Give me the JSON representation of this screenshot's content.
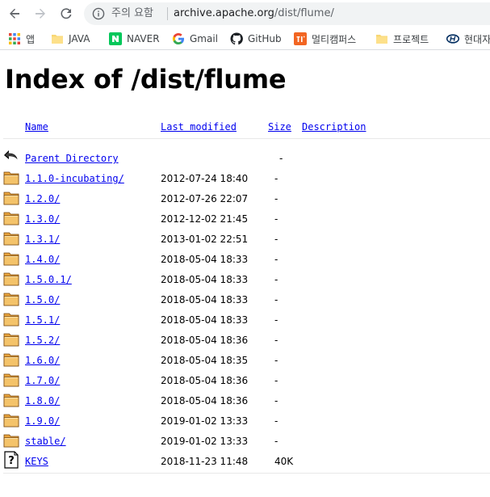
{
  "browser": {
    "security_label": "주의 요함",
    "url_host": "archive.apache.org",
    "url_path": "/dist/flume/"
  },
  "bookmarks": [
    {
      "label": "앱",
      "icon": "apps-grid-icon"
    },
    {
      "label": "JAVA",
      "icon": "folder-icon"
    },
    {
      "label": "NAVER",
      "icon": "naver-icon"
    },
    {
      "label": "Gmail",
      "icon": "google-icon"
    },
    {
      "label": "GitHub",
      "icon": "github-icon"
    },
    {
      "label": "멀티캠퍼스",
      "icon": "multicampus-icon"
    },
    {
      "label": "프로젝트",
      "icon": "folder-icon"
    },
    {
      "label": "현대자",
      "icon": "hyundai-icon"
    }
  ],
  "page": {
    "title": "Index of /dist/flume",
    "columns": {
      "name": "Name",
      "last_modified": "Last modified",
      "size": "Size",
      "description": "Description"
    },
    "parent": {
      "name": "Parent Directory",
      "size": "-"
    },
    "entries": [
      {
        "name": "1.1.0-incubating/",
        "date": "2012-07-24 18:40",
        "size": "-",
        "type": "folder"
      },
      {
        "name": "1.2.0/",
        "date": "2012-07-26 22:07",
        "size": "-",
        "type": "folder"
      },
      {
        "name": "1.3.0/",
        "date": "2012-12-02 21:45",
        "size": "-",
        "type": "folder"
      },
      {
        "name": "1.3.1/",
        "date": "2013-01-02 22:51",
        "size": "-",
        "type": "folder"
      },
      {
        "name": "1.4.0/",
        "date": "2018-05-04 18:33",
        "size": "-",
        "type": "folder"
      },
      {
        "name": "1.5.0.1/",
        "date": "2018-05-04 18:33",
        "size": "-",
        "type": "folder"
      },
      {
        "name": "1.5.0/",
        "date": "2018-05-04 18:33",
        "size": "-",
        "type": "folder"
      },
      {
        "name": "1.5.1/",
        "date": "2018-05-04 18:33",
        "size": "-",
        "type": "folder"
      },
      {
        "name": "1.5.2/",
        "date": "2018-05-04 18:36",
        "size": "-",
        "type": "folder"
      },
      {
        "name": "1.6.0/",
        "date": "2018-05-04 18:35",
        "size": "-",
        "type": "folder"
      },
      {
        "name": "1.7.0/",
        "date": "2018-05-04 18:36",
        "size": "-",
        "type": "folder"
      },
      {
        "name": "1.8.0/",
        "date": "2018-05-04 18:36",
        "size": "-",
        "type": "folder"
      },
      {
        "name": "1.9.0/",
        "date": "2019-01-02 13:33",
        "size": "-",
        "type": "folder"
      },
      {
        "name": "stable/",
        "date": "2019-01-02 13:33",
        "size": "-",
        "type": "folder"
      },
      {
        "name": "KEYS",
        "date": "2018-11-23 11:48",
        "size": "40K",
        "type": "file"
      }
    ]
  }
}
